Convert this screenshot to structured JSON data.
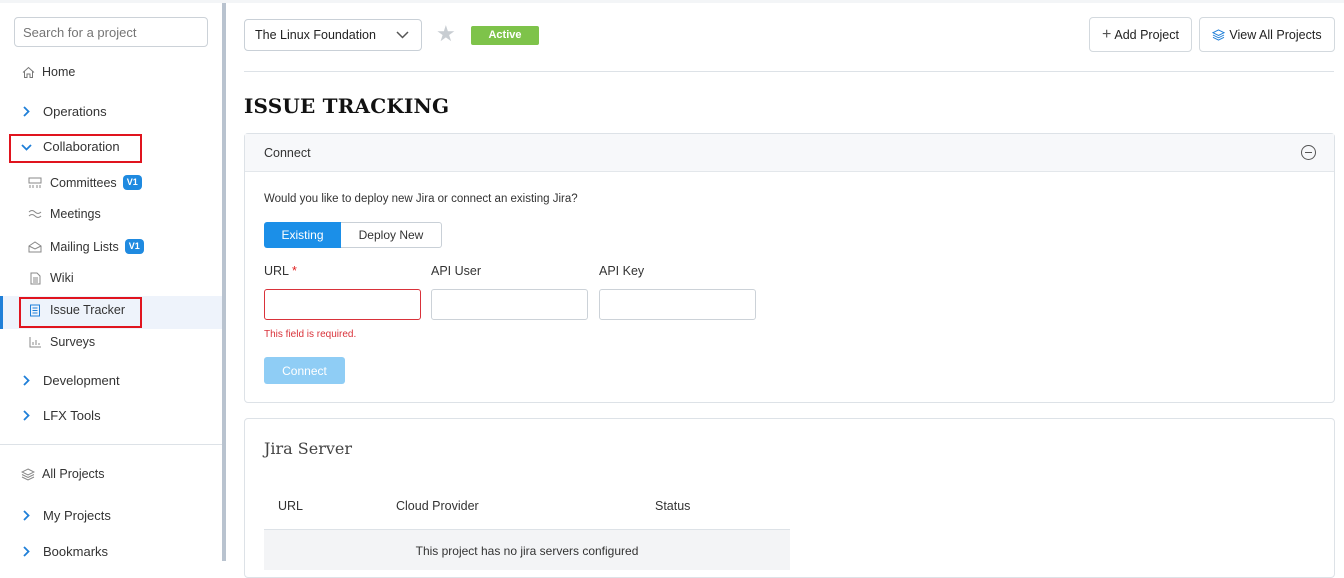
{
  "sidebar": {
    "search_placeholder": "Search for a project",
    "home": "Home",
    "operations": "Operations",
    "collaboration": "Collaboration",
    "sub_items": [
      {
        "label": "Committees",
        "badge": "V1"
      },
      {
        "label": "Meetings"
      },
      {
        "label": "Mailing Lists",
        "badge": "V1"
      },
      {
        "label": "Wiki"
      },
      {
        "label": "Issue Tracker"
      },
      {
        "label": "Surveys"
      }
    ],
    "development": "Development",
    "lfx_tools": "LFX Tools",
    "all_projects": "All Projects",
    "my_projects": "My Projects",
    "bookmarks": "Bookmarks",
    "accent_color": "#1f7fd8",
    "highlight_color": "#e0141e"
  },
  "header": {
    "project_name": "The Linux Foundation",
    "status": "Active",
    "status_color": "#7ec34a",
    "add_project": "Add Project",
    "view_all_projects": "View All Projects"
  },
  "page": {
    "title": "ISSUE TRACKING"
  },
  "connect_panel": {
    "title": "Connect",
    "question": "Would you like to deploy new Jira or connect an existing Jira?",
    "tabs": [
      "Existing",
      "Deploy New"
    ],
    "fields": {
      "url_label": "URL",
      "required_mark": "*",
      "api_user_label": "API User",
      "api_key_label": "API Key",
      "url_value": "",
      "api_user_value": "",
      "api_key_value": ""
    },
    "error": "This field is required.",
    "connect_button": "Connect"
  },
  "jira_server": {
    "title": "Jira Server",
    "columns": [
      "URL",
      "Cloud Provider",
      "Status"
    ],
    "empty_message": "This project has no jira servers configured"
  }
}
